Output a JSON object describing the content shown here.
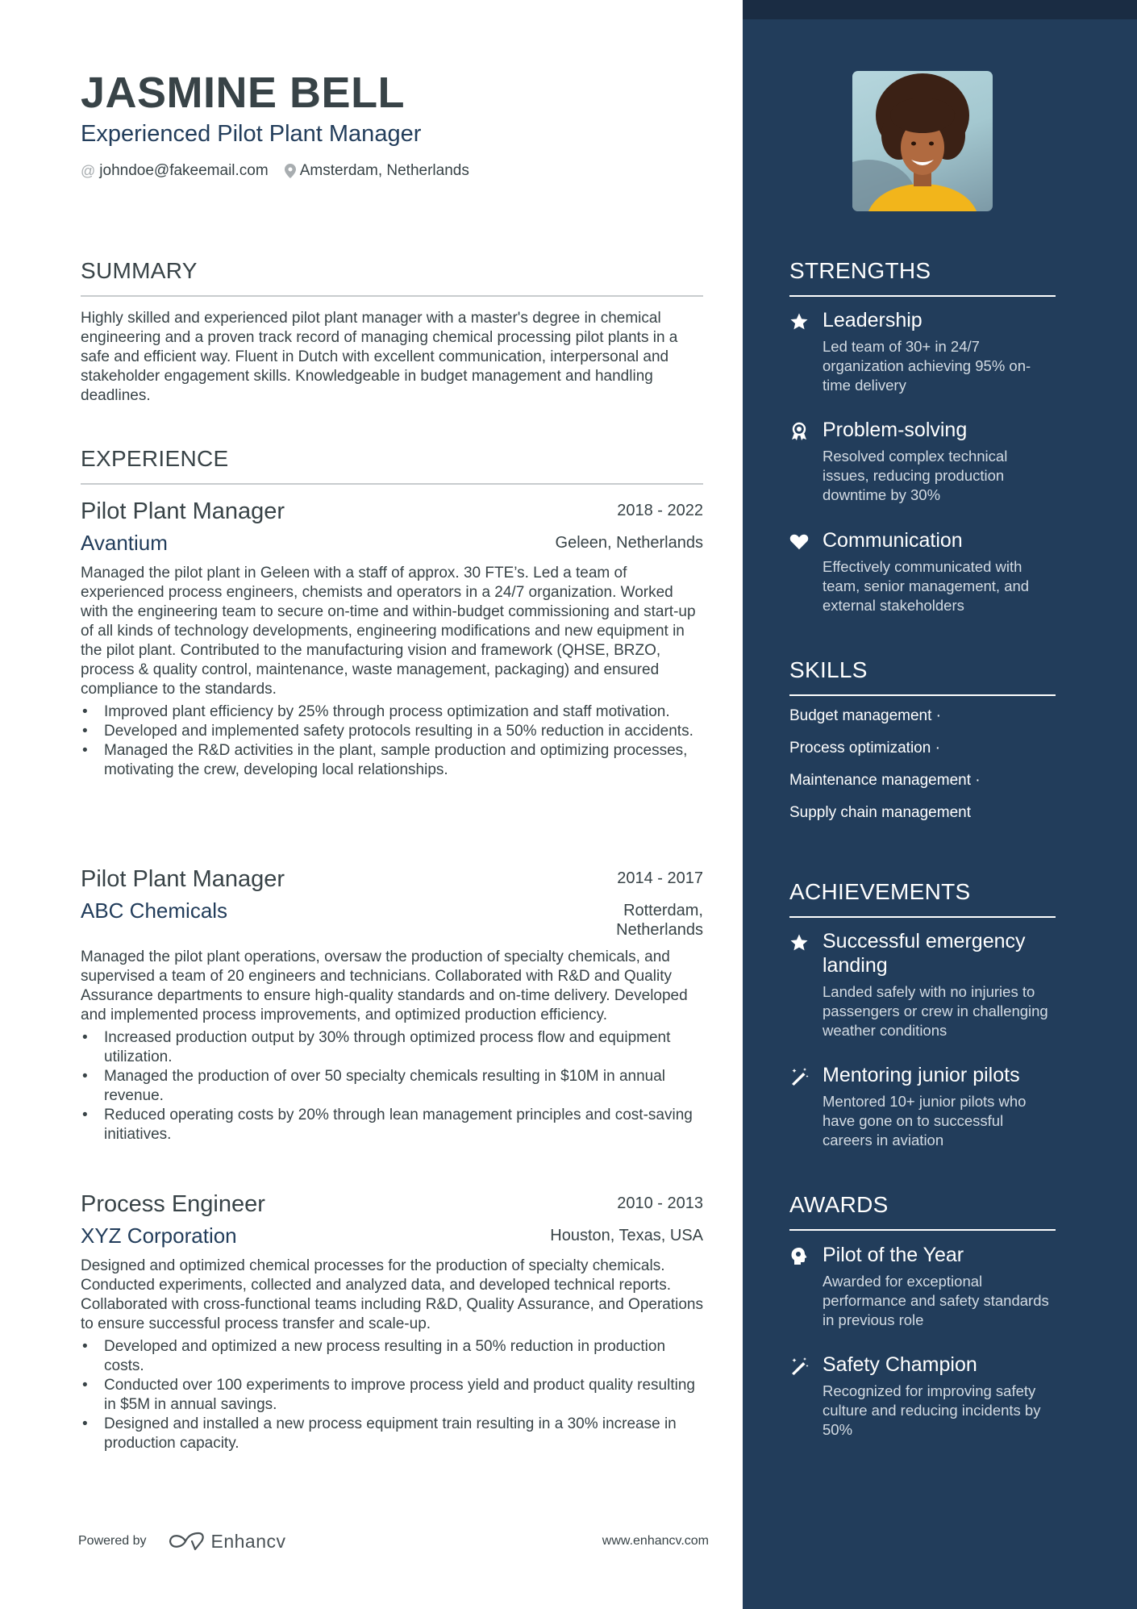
{
  "header": {
    "name": "JASMINE BELL",
    "title": "Experienced Pilot Plant Manager",
    "email": "johndoe@fakeemail.com",
    "location": "Amsterdam, Netherlands",
    "email_icon": "at-icon",
    "location_icon": "map-pin-icon"
  },
  "summary": {
    "heading": "SUMMARY",
    "text": "Highly skilled and experienced pilot plant manager with a master's degree in chemical engineering and a proven track record of managing chemical processing pilot plants in a safe and efficient way. Fluent in Dutch with excellent communication, interpersonal and stakeholder engagement skills. Knowledgeable in budget management and handling deadlines."
  },
  "experience": {
    "heading": "EXPERIENCE",
    "jobs": [
      {
        "title": "Pilot Plant Manager",
        "dates": "2018 - 2022",
        "company": "Avantium",
        "location": "Geleen, Netherlands",
        "description": "Managed the pilot plant in Geleen with a staff of approx. 30 FTE’s. Led a team of experienced process engineers, chemists and operators in a 24/7 organization. Worked with the engineering team to secure on-time and within-budget commissioning and start-up of all kinds of technology developments, engineering modifications and new equipment in the pilot plant. Contributed to the manufacturing vision and framework (QHSE, BRZO, process & quality control, maintenance, waste management, packaging) and ensured compliance to the standards.",
        "bullets": [
          "Improved plant efficiency by 25% through process optimization and staff motivation.",
          "Developed and implemented safety protocols resulting in a 50% reduction in accidents.",
          "Managed the R&D activities in the plant, sample production and optimizing processes, motivating the crew, developing local relationships."
        ]
      },
      {
        "title": "Pilot Plant Manager",
        "dates": "2014 - 2017",
        "company": "ABC Chemicals",
        "location_line1": "Rotterdam,",
        "location_line2": "Netherlands",
        "description": "Managed the pilot plant operations, oversaw the production of specialty chemicals, and supervised a team of 20 engineers and technicians. Collaborated with R&D and Quality Assurance departments to ensure high-quality standards and on-time delivery. Developed and implemented process improvements, and optimized production efficiency.",
        "bullets": [
          "Increased production output by 30% through optimized process flow and equipment utilization.",
          "Managed the production of over 50 specialty chemicals resulting in $10M in annual revenue.",
          "Reduced operating costs by 20% through lean management principles and cost-saving initiatives."
        ]
      },
      {
        "title": "Process Engineer",
        "dates": "2010 - 2013",
        "company": "XYZ Corporation",
        "location": "Houston, Texas, USA",
        "description": "Designed and optimized chemical processes for the production of specialty chemicals. Conducted experiments, collected and analyzed data, and developed technical reports. Collaborated with cross-functional teams including R&D, Quality Assurance, and Operations to ensure successful process transfer and scale-up.",
        "bullets": [
          "Developed and optimized a new process resulting in a 50% reduction in production costs.",
          "Conducted over 100 experiments to improve process yield and product quality resulting in $5M in annual savings.",
          "Designed and installed a new process equipment train resulting in a 30% increase in production capacity."
        ]
      }
    ]
  },
  "strengths": {
    "heading": "STRENGTHS",
    "items": [
      {
        "icon": "star-icon",
        "title": "Leadership",
        "description": "Led team of 30+ in 24/7 organization achieving 95% on-time delivery"
      },
      {
        "icon": "award-ribbon-icon",
        "title": "Problem-solving",
        "description": "Resolved complex technical issues, reducing production downtime by 30%"
      },
      {
        "icon": "heart-icon",
        "title": "Communication",
        "description": "Effectively communicated with team, senior management, and external stakeholders"
      }
    ]
  },
  "skills": {
    "heading": "SKILLS",
    "items": [
      "Budget management ·",
      "Process optimization ·",
      "Maintenance management ·",
      "Supply chain management"
    ]
  },
  "achievements": {
    "heading": "ACHIEVEMENTS",
    "items": [
      {
        "icon": "star-icon",
        "title": "Successful emergency landing",
        "description": "Landed safely with no injuries to passengers or crew in challenging weather conditions"
      },
      {
        "icon": "magic-wand-icon",
        "title": "Mentoring junior pilots",
        "description": "Mentored 10+ junior pilots who have gone on to successful careers in aviation"
      }
    ]
  },
  "awards": {
    "heading": "AWARDS",
    "items": [
      {
        "icon": "head-brain-icon",
        "title": "Pilot of the Year",
        "description": "Awarded for exceptional performance and safety standards in previous role"
      },
      {
        "icon": "magic-wand-icon",
        "title": "Safety Champion",
        "description": "Recognized for improving safety culture and reducing incidents by 50%"
      }
    ]
  },
  "footer": {
    "powered_by": "Powered by",
    "brand": "Enhancv",
    "website": "www.enhancv.com"
  },
  "colors": {
    "sidebar": "#223d5b",
    "sidebar_top": "#1a2c43",
    "accent": "#223d5b",
    "text": "#384347"
  }
}
